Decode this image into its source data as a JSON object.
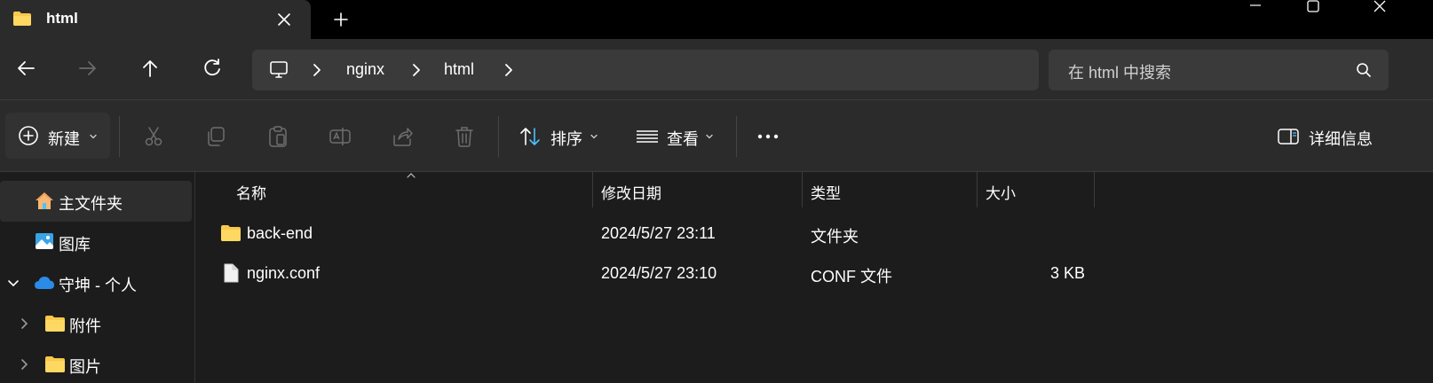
{
  "tab": {
    "title": "html"
  },
  "breadcrumb": {
    "items": [
      "nginx",
      "html"
    ]
  },
  "search": {
    "placeholder": "在 html 中搜索"
  },
  "toolbar": {
    "new_label": "新建",
    "sort_label": "排序",
    "view_label": "查看",
    "details_label": "详细信息"
  },
  "sidebar": {
    "items": [
      {
        "label": "主文件夹",
        "icon": "home-icon"
      },
      {
        "label": "图库",
        "icon": "gallery-icon"
      },
      {
        "label": "守坤 - 个人",
        "icon": "onedrive-icon"
      },
      {
        "label": "附件",
        "icon": "folder-icon"
      },
      {
        "label": "图片",
        "icon": "folder-icon"
      }
    ]
  },
  "columns": {
    "name": "名称",
    "modified": "修改日期",
    "type": "类型",
    "size": "大小"
  },
  "files": [
    {
      "name": "back-end",
      "modified": "2024/5/27 23:11",
      "type": "文件夹",
      "size": "",
      "icon": "folder-icon"
    },
    {
      "name": "nginx.conf",
      "modified": "2024/5/27 23:10",
      "type": "CONF 文件",
      "size": "3 KB",
      "icon": "file-icon"
    }
  ],
  "colors": {
    "background": "#1c1c1c",
    "panel": "#2b2b2b",
    "folder": "#f8c94a",
    "accent": "#4cc2ff"
  }
}
